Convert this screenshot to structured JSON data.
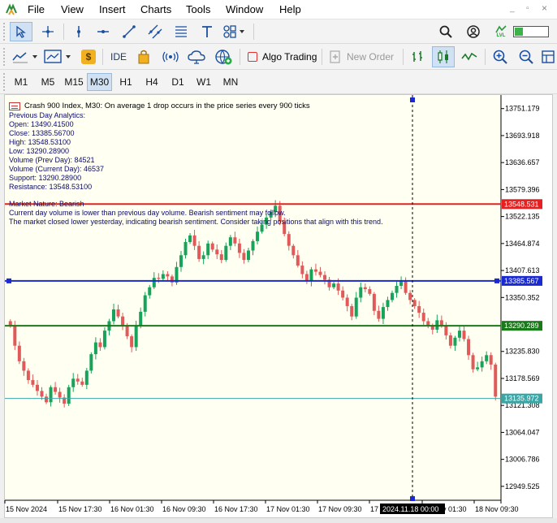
{
  "menu": {
    "items": [
      "File",
      "View",
      "Insert",
      "Charts",
      "Tools",
      "Window",
      "Help"
    ]
  },
  "window_controls": [
    "minimize-icon",
    "restore-icon",
    "close-icon"
  ],
  "toolbar": {
    "drawing_tools": [
      "cursor-icon",
      "crosshair-icon",
      "vertical-line-icon",
      "horizontal-line-icon",
      "trendline-icon",
      "channel-icon",
      "fibonacci-icon",
      "text-icon",
      "shapes-icon"
    ],
    "right_icons": [
      "search-icon",
      "account-icon",
      "lvl-signal-icon",
      "battery-icon"
    ],
    "lvl_label": "LVL",
    "ide_label": "IDE",
    "algo_label": "Algo Trading",
    "new_order_label": "New Order",
    "algo_color": "#e03030"
  },
  "timeframes": {
    "items": [
      "M1",
      "M5",
      "M15",
      "M30",
      "H1",
      "H4",
      "D1",
      "W1",
      "MN"
    ],
    "selected": "M30"
  },
  "info": {
    "symbol_line": "Crash 900 Index, M30:  On average 1 drop occurs in the price series every 900 ticks",
    "analytics": [
      "Previous Day Analytics:",
      "Open: 13490.41500",
      "Close: 13385.56700",
      "High: 13548.53100",
      "Low: 13290.28900",
      "Volume (Prev Day): 84521",
      "Volume (Current Day): 46537",
      "Support: 13290.28900",
      "Resistance: 13548.53100"
    ],
    "nature": [
      "Market Nature: Bearish",
      "Current day volume is lower than previous day volume. Bearish sentiment may follow.",
      "The market closed lower yesterday, indicating bearish sentiment. Consider taking positions that align with this trend."
    ]
  },
  "chart_data": {
    "type": "candlestick",
    "colors": {
      "up": "#18a35a",
      "down": "#e05a5a",
      "wick_up": "#18a35a",
      "wick_down": "#e05a5a"
    },
    "ylim": [
      12920,
      13780
    ],
    "price_ticks": [
      "13751.179",
      "13693.918",
      "13636.657",
      "13579.396",
      "13522.135",
      "13464.874",
      "13407.613",
      "13350.352",
      "13235.830",
      "13178.569",
      "13121.308",
      "13064.047",
      "13006.786",
      "12949.525"
    ],
    "time_labels": [
      "15 Nov 2024",
      "15 Nov 17:30",
      "16 Nov 01:30",
      "16 Nov 09:30",
      "16 Nov 17:30",
      "17 Nov 01:30",
      "17 Nov 09:30",
      "17",
      "18 Nov 01:30",
      "18 Nov 09:30"
    ],
    "crosshair_time": "2024.11.18 00:00",
    "levels": [
      {
        "name": "resistance",
        "price": 13548.531,
        "label": "13548.531",
        "color": "#e52020"
      },
      {
        "name": "previous-close",
        "price": 13385.567,
        "label": "13385.567",
        "color": "#1a2ad0"
      },
      {
        "name": "support",
        "price": 13290.289,
        "label": "13290.289",
        "color": "#1a7a1a"
      },
      {
        "name": "bid",
        "price": 13135.972,
        "label": "13135.972",
        "color": "#3aa6a6"
      }
    ],
    "closes": [
      13290,
      13248,
      13215,
      13195,
      13175,
      13165,
      13152,
      13140,
      13128,
      13160,
      13150,
      13138,
      13125,
      13160,
      13178,
      13172,
      13165,
      13195,
      13230,
      13255,
      13245,
      13280,
      13300,
      13325,
      13310,
      13290,
      13268,
      13245,
      13290,
      13320,
      13355,
      13372,
      13392,
      13390,
      13400,
      13395,
      13382,
      13415,
      13440,
      13468,
      13482,
      13460,
      13432,
      13440,
      13465,
      13452,
      13442,
      13430,
      13460,
      13478,
      13465,
      13445,
      13430,
      13450,
      13470,
      13490,
      13505,
      13520,
      13532,
      13545,
      13512,
      13485,
      13460,
      13440,
      13418,
      13400,
      13385,
      13410,
      13405,
      13398,
      13388,
      13372,
      13380,
      13365,
      13350,
      13332,
      13310,
      13350,
      13372,
      13368,
      13358,
      13322,
      13305,
      13330,
      13345,
      13360,
      13375,
      13385,
      13360,
      13345,
      13332,
      13318,
      13300,
      13290,
      13282,
      13302,
      13290,
      13270,
      13248,
      13265,
      13280,
      13262,
      13228,
      13198,
      13202,
      13215,
      13228,
      13208,
      13140
    ]
  }
}
